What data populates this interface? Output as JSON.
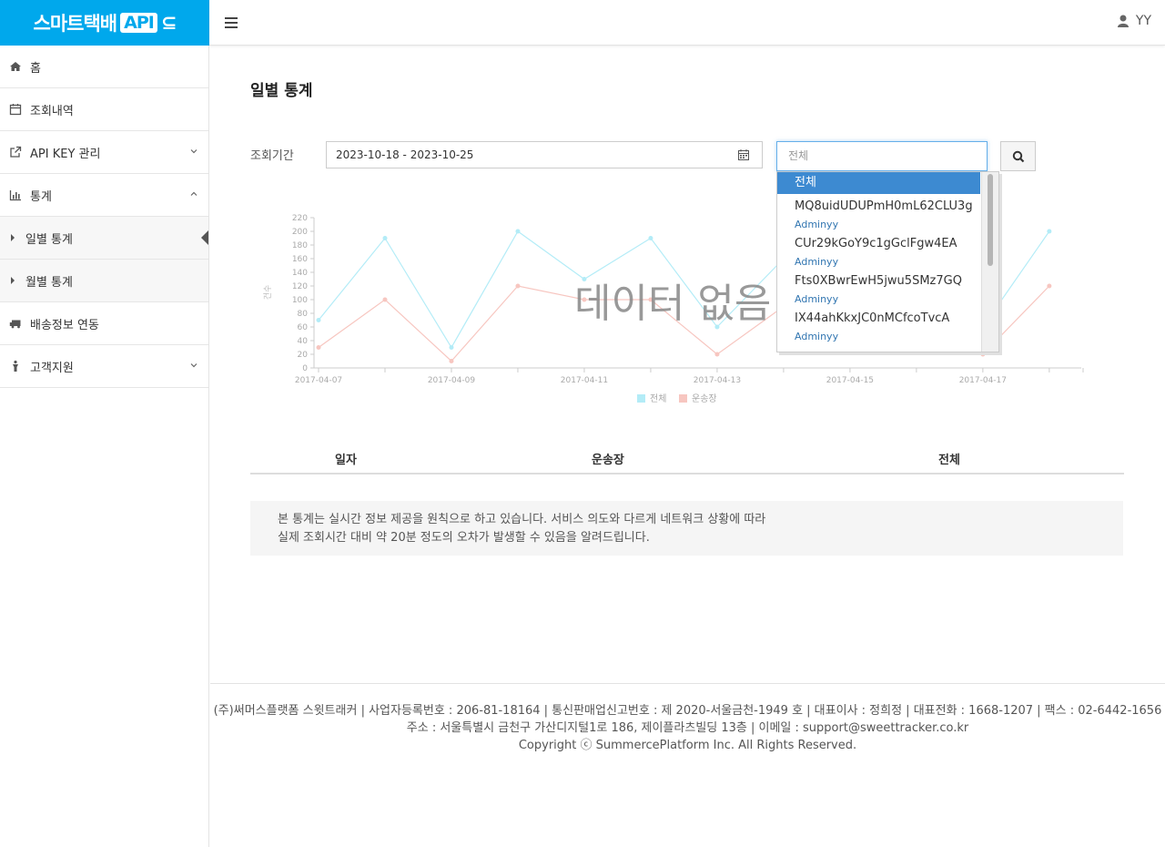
{
  "header": {
    "logo_text": "스마트택배",
    "logo_api": "API",
    "logo_suffix": "⊆",
    "user": "YY"
  },
  "sidebar": {
    "items": [
      {
        "label": "홈"
      },
      {
        "label": "조회내역"
      },
      {
        "label": "API KEY 관리"
      },
      {
        "label": "통계"
      },
      {
        "label": "일별 통계"
      },
      {
        "label": "월별 통계"
      },
      {
        "label": "배송정보 연동"
      },
      {
        "label": "고객지원"
      }
    ]
  },
  "main": {
    "title": "일별 통계",
    "period_label": "조회기간",
    "date_range": "2023-10-18 - 2023-10-25",
    "select_placeholder": "전체",
    "no_data": "데이터 없음",
    "table_headers": [
      "일자",
      "운송장",
      "전체"
    ],
    "notice_line1": "본 통계는 실시간 정보 제공을 원칙으로 하고 있습니다. 서비스 의도와 다르게 네트워크 상황에 따라",
    "notice_line2": "실제 조회시간 대비 약 20분 정도의 오차가 발생할 수 있음을 알려드립니다."
  },
  "dropdown": {
    "selected": "전체",
    "options": [
      {
        "key": "MQ8uidUDUPmH0mL62CLU3g",
        "user": "Adminyy"
      },
      {
        "key": "CUr29kGoY9c1gGclFgw4EA",
        "user": "Adminyy"
      },
      {
        "key": "Fts0XBwrEwH5jwu5SMz7GQ",
        "user": "Adminyy"
      },
      {
        "key": "IX44ahKkxJC0nMCfcoTvcA",
        "user": "Adminyy"
      }
    ]
  },
  "chart_data": {
    "type": "line",
    "ylabel": "건수",
    "ylim": [
      0,
      220
    ],
    "yticks": [
      0,
      20,
      40,
      60,
      80,
      100,
      120,
      140,
      160,
      180,
      200,
      220
    ],
    "x": [
      "2017-04-07",
      "2017-04-08",
      "2017-04-09",
      "2017-04-10",
      "2017-04-11",
      "2017-04-12",
      "2017-04-13",
      "2017-04-14",
      "2017-04-15",
      "2017-04-16",
      "2017-04-17",
      "2017-04-18"
    ],
    "xtick_labels": [
      "2017-04-07",
      "2017-04-09",
      "2017-04-11",
      "2017-04-13",
      "2017-04-15",
      "2017-04-17"
    ],
    "series": [
      {
        "name": "전체",
        "color": "#b3ecf7",
        "values": [
          70,
          190,
          30,
          200,
          130,
          190,
          60,
          160,
          150,
          130,
          60,
          200
        ]
      },
      {
        "name": "운송장",
        "color": "#f7c6c0",
        "values": [
          30,
          100,
          10,
          120,
          100,
          100,
          20,
          90,
          80,
          50,
          20,
          120
        ]
      }
    ],
    "legend": "bottom-center"
  },
  "footer": {
    "line1": "(주)써머스플랫폼 스윗트래커  |  사업자등록번호 : 206-81-18164  |  통신판매업신고번호 : 제 2020-서울금천-1949 호 | 대표이사 : 정희정  |  대표전화 : 1668-1207  |  팩스 : 02-6442-1656",
    "line2": "주소 : 서울특별시 금천구 가산디지털1로 186, 제이플라츠빌딩 13층  |  이메일 : support@sweettracker.co.kr",
    "line3": "Copyright ⓒ SummercePlatform Inc. All Rights Reserved."
  }
}
